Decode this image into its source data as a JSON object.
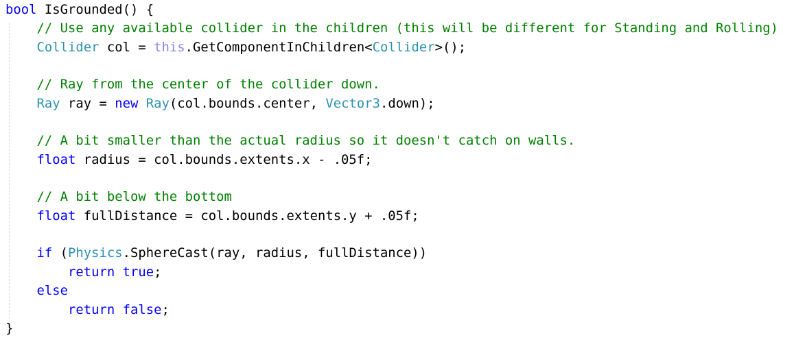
{
  "colors": {
    "keyword": "#0000ff",
    "type": "#2b91af",
    "comment": "#008000",
    "this_keyword": "#8a8ae6",
    "text": "#000000",
    "background": "#ffffff"
  },
  "code_lines": [
    [
      {
        "t": "kw",
        "v": "bool"
      },
      {
        "t": "txt",
        "v": " IsGrounded() {"
      }
    ],
    [
      {
        "t": "txt",
        "v": "    "
      },
      {
        "t": "cmt",
        "v": "// Use any available collider in the children (this will be different for Standing and Rolling)"
      }
    ],
    [
      {
        "t": "txt",
        "v": "    "
      },
      {
        "t": "type",
        "v": "Collider"
      },
      {
        "t": "txt",
        "v": " col = "
      },
      {
        "t": "this",
        "v": "this"
      },
      {
        "t": "txt",
        "v": ".GetComponentInChildren<"
      },
      {
        "t": "type",
        "v": "Collider"
      },
      {
        "t": "txt",
        "v": ">();"
      }
    ],
    [
      {
        "t": "txt",
        "v": ""
      }
    ],
    [
      {
        "t": "txt",
        "v": "    "
      },
      {
        "t": "cmt",
        "v": "// Ray from the center of the collider down."
      }
    ],
    [
      {
        "t": "txt",
        "v": "    "
      },
      {
        "t": "type",
        "v": "Ray"
      },
      {
        "t": "txt",
        "v": " ray = "
      },
      {
        "t": "kw",
        "v": "new"
      },
      {
        "t": "txt",
        "v": " "
      },
      {
        "t": "type",
        "v": "Ray"
      },
      {
        "t": "txt",
        "v": "(col.bounds.center, "
      },
      {
        "t": "type",
        "v": "Vector3"
      },
      {
        "t": "txt",
        "v": ".down);"
      }
    ],
    [
      {
        "t": "txt",
        "v": ""
      }
    ],
    [
      {
        "t": "txt",
        "v": "    "
      },
      {
        "t": "cmt",
        "v": "// A bit smaller than the actual radius so it doesn't catch on walls."
      }
    ],
    [
      {
        "t": "txt",
        "v": "    "
      },
      {
        "t": "kw",
        "v": "float"
      },
      {
        "t": "txt",
        "v": " radius = col.bounds.extents.x - .05f;"
      }
    ],
    [
      {
        "t": "txt",
        "v": ""
      }
    ],
    [
      {
        "t": "txt",
        "v": "    "
      },
      {
        "t": "cmt",
        "v": "// A bit below the bottom"
      }
    ],
    [
      {
        "t": "txt",
        "v": "    "
      },
      {
        "t": "kw",
        "v": "float"
      },
      {
        "t": "txt",
        "v": " fullDistance = col.bounds.extents.y + .05f;"
      }
    ],
    [
      {
        "t": "txt",
        "v": ""
      }
    ],
    [
      {
        "t": "txt",
        "v": "    "
      },
      {
        "t": "kw",
        "v": "if"
      },
      {
        "t": "txt",
        "v": " ("
      },
      {
        "t": "type",
        "v": "Physics"
      },
      {
        "t": "txt",
        "v": ".SphereCast(ray, radius, fullDistance))"
      }
    ],
    [
      {
        "t": "txt",
        "v": "        "
      },
      {
        "t": "kw",
        "v": "return"
      },
      {
        "t": "txt",
        "v": " "
      },
      {
        "t": "kw",
        "v": "true"
      },
      {
        "t": "txt",
        "v": ";"
      }
    ],
    [
      {
        "t": "txt",
        "v": "    "
      },
      {
        "t": "kw",
        "v": "else"
      }
    ],
    [
      {
        "t": "txt",
        "v": "        "
      },
      {
        "t": "kw",
        "v": "return"
      },
      {
        "t": "txt",
        "v": " "
      },
      {
        "t": "kw",
        "v": "false"
      },
      {
        "t": "txt",
        "v": ";"
      }
    ],
    [
      {
        "t": "txt",
        "v": "}"
      }
    ]
  ]
}
